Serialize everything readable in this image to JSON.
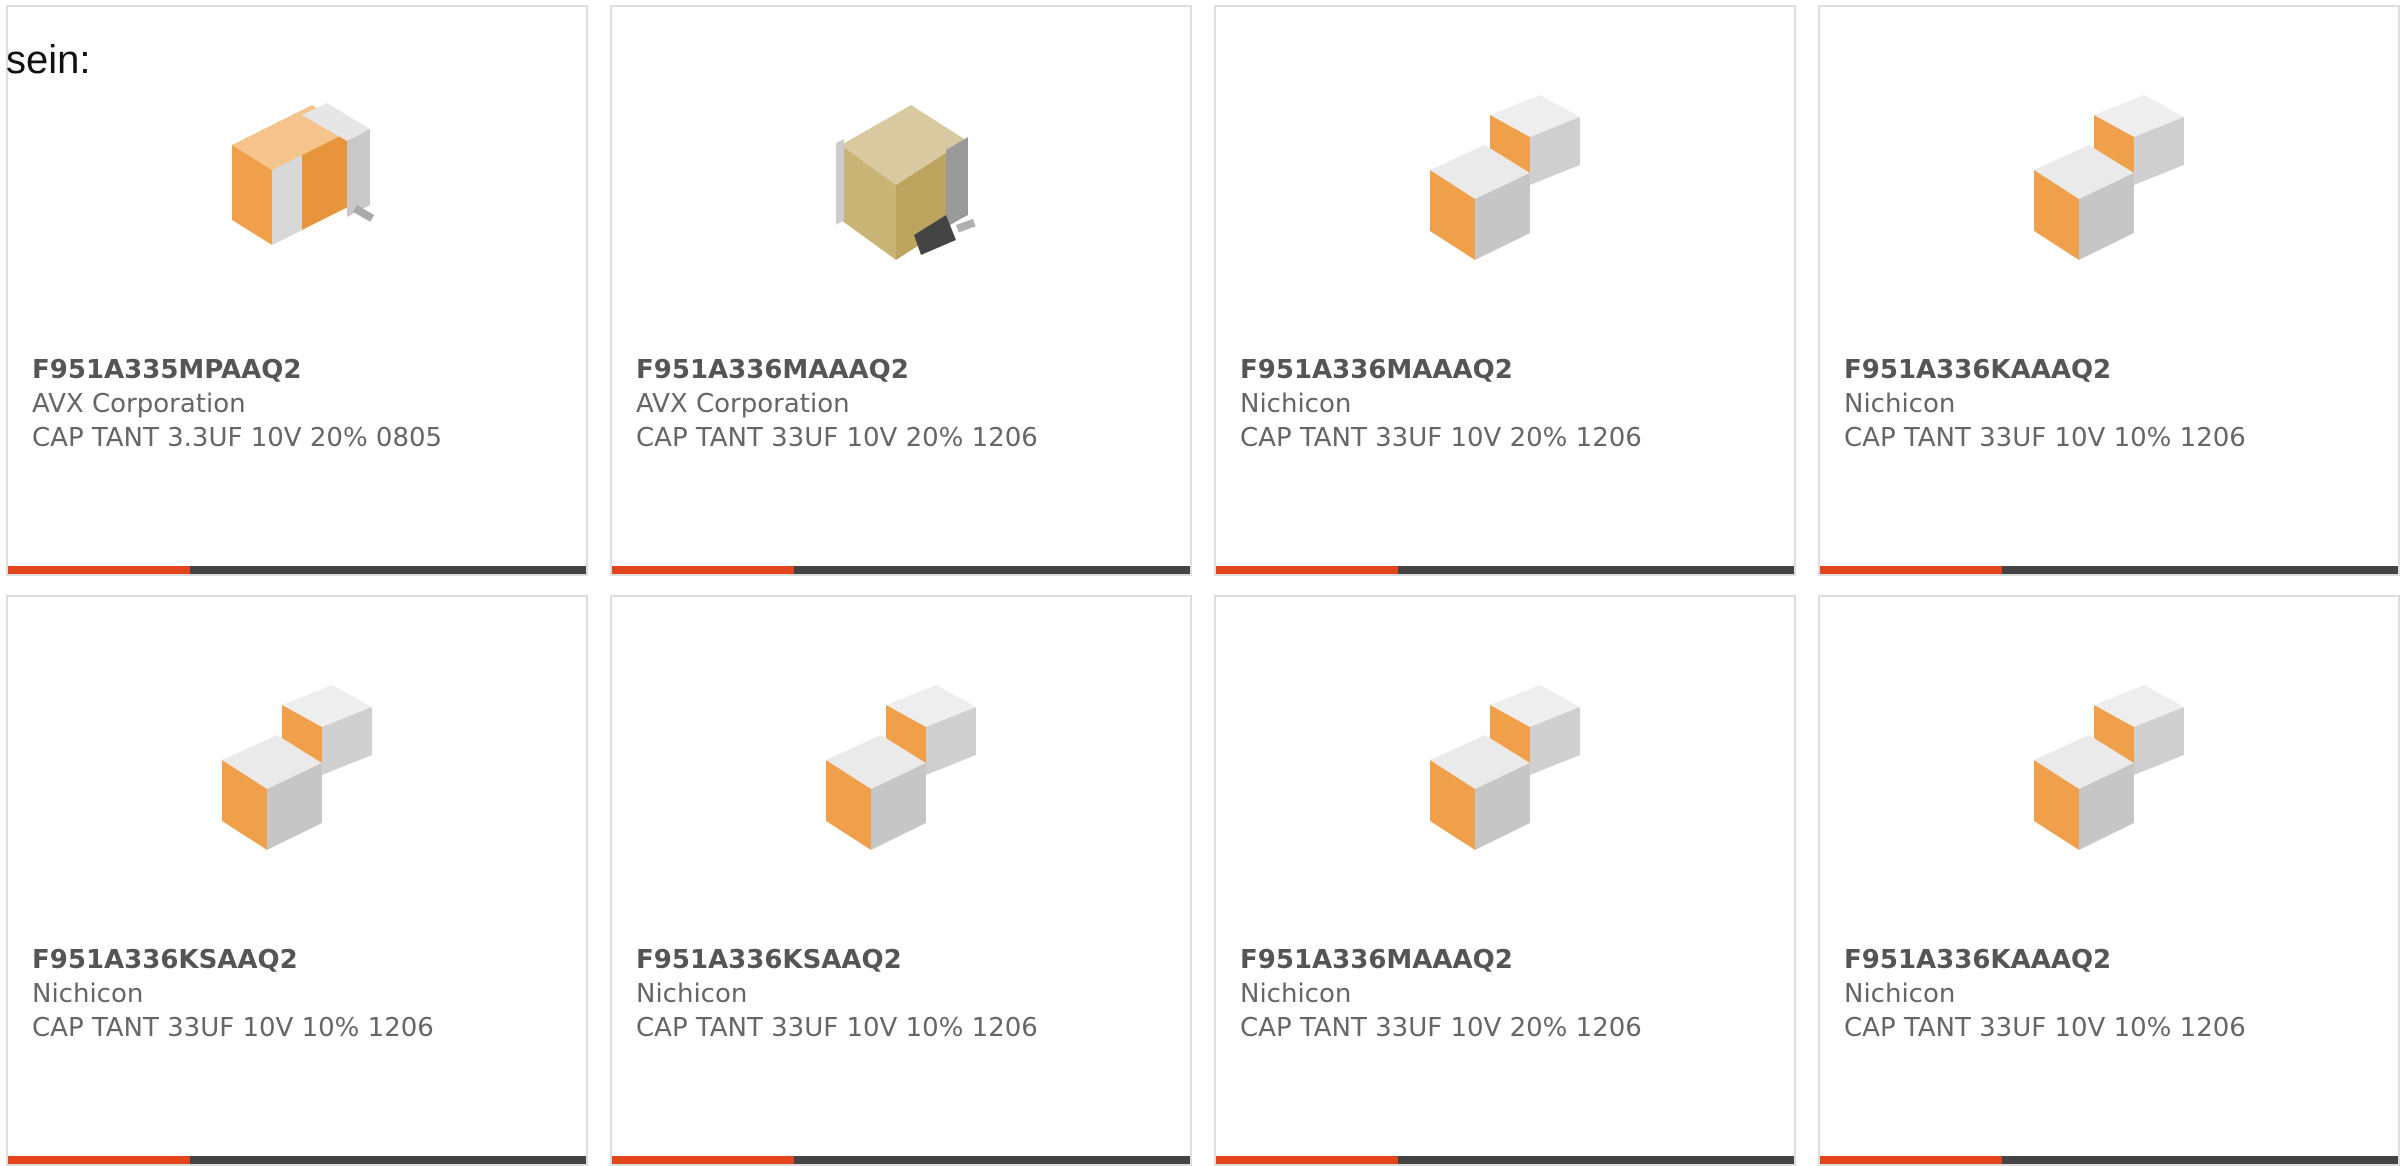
{
  "intro": "sein:",
  "colors": {
    "accent": "#e2441b",
    "bar": "#444444",
    "border": "#dddddd"
  },
  "products": [
    {
      "part": "F951A335MPAAQ2",
      "manufacturer": "AVX Corporation",
      "description": "CAP TANT 3.3UF 10V 20% 0805",
      "image": "single-chip-capacitor-icon"
    },
    {
      "part": "F951A336MAAAQ2",
      "manufacturer": "AVX Corporation",
      "description": "CAP TANT 33UF 10V 20% 1206",
      "image": "molded-tantalum-capacitor-icon"
    },
    {
      "part": "F951A336MAAAQ2",
      "manufacturer": "Nichicon",
      "description": "CAP TANT 33UF 10V 20% 1206",
      "image": "dual-chip-capacitor-icon"
    },
    {
      "part": "F951A336KAAAQ2",
      "manufacturer": "Nichicon",
      "description": "CAP TANT 33UF 10V 10% 1206",
      "image": "dual-chip-capacitor-icon"
    },
    {
      "part": "F951A336KSAAQ2",
      "manufacturer": "Nichicon",
      "description": "CAP TANT 33UF 10V 10% 1206",
      "image": "dual-chip-capacitor-icon"
    },
    {
      "part": "F951A336KSAAQ2",
      "manufacturer": "Nichicon",
      "description": "CAP TANT 33UF 10V 10% 1206",
      "image": "dual-chip-capacitor-icon"
    },
    {
      "part": "F951A336MAAAQ2",
      "manufacturer": "Nichicon",
      "description": "CAP TANT 33UF 10V 20% 1206",
      "image": "dual-chip-capacitor-icon"
    },
    {
      "part": "F951A336KAAAQ2",
      "manufacturer": "Nichicon",
      "description": "CAP TANT 33UF 10V 10% 1206",
      "image": "dual-chip-capacitor-icon"
    }
  ]
}
